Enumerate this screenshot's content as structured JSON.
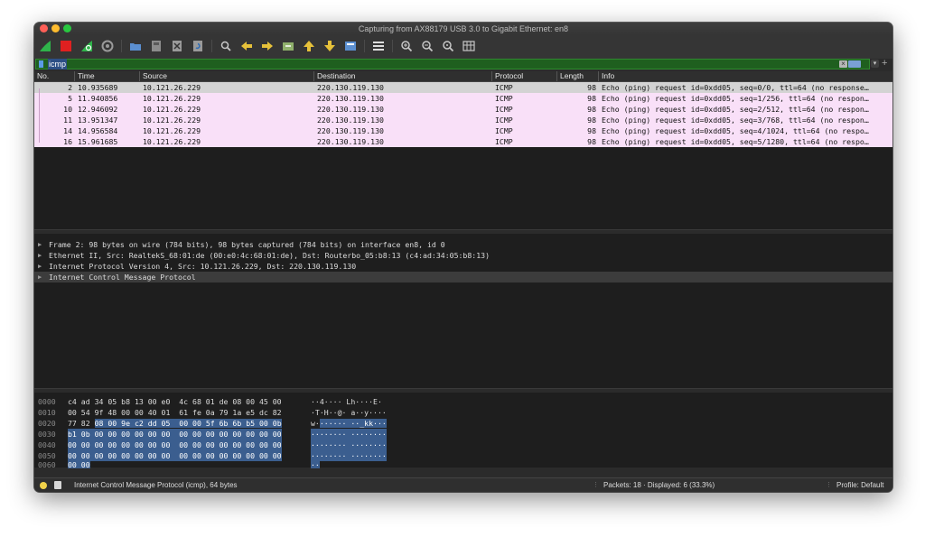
{
  "window": {
    "title": "Capturing from AX88179 USB 3.0 to Gigabit Ethernet: en8"
  },
  "toolbar": {
    "icons": [
      "shark-fin-start-icon",
      "stop-icon",
      "shark-fin-restart-icon",
      "gear-options-icon",
      "folder-open-icon",
      "file-save-icon",
      "file-close-icon",
      "reload-icon",
      "search-icon",
      "back-arrow-icon",
      "forward-arrow-icon",
      "go-to-packet-icon",
      "first-packet-icon",
      "last-packet-icon",
      "autoscroll-icon",
      "colorize-icon",
      "zoom-in-icon",
      "zoom-out-icon",
      "zoom-normal-icon",
      "resize-columns-icon"
    ]
  },
  "filter": {
    "value": "icmp"
  },
  "columns": [
    "No.",
    "Time",
    "Source",
    "Destination",
    "Protocol",
    "Length",
    "Info"
  ],
  "packets": [
    {
      "no": "2",
      "time": "10.935689",
      "src": "10.121.26.229",
      "dst": "220.130.119.130",
      "proto": "ICMP",
      "len": "98",
      "info": "Echo (ping) request  id=0xdd05, seq=0/0, ttl=64 (no response…"
    },
    {
      "no": "5",
      "time": "11.940856",
      "src": "10.121.26.229",
      "dst": "220.130.119.130",
      "proto": "ICMP",
      "len": "98",
      "info": "Echo (ping) request  id=0xdd05, seq=1/256, ttl=64 (no respon…"
    },
    {
      "no": "10",
      "time": "12.946092",
      "src": "10.121.26.229",
      "dst": "220.130.119.130",
      "proto": "ICMP",
      "len": "98",
      "info": "Echo (ping) request  id=0xdd05, seq=2/512, ttl=64 (no respon…"
    },
    {
      "no": "11",
      "time": "13.951347",
      "src": "10.121.26.229",
      "dst": "220.130.119.130",
      "proto": "ICMP",
      "len": "98",
      "info": "Echo (ping) request  id=0xdd05, seq=3/768, ttl=64 (no respon…"
    },
    {
      "no": "14",
      "time": "14.956584",
      "src": "10.121.26.229",
      "dst": "220.130.119.130",
      "proto": "ICMP",
      "len": "98",
      "info": "Echo (ping) request  id=0xdd05, seq=4/1024, ttl=64 (no respo…"
    },
    {
      "no": "16",
      "time": "15.961685",
      "src": "10.121.26.229",
      "dst": "220.130.119.130",
      "proto": "ICMP",
      "len": "98",
      "info": "Echo (ping) request  id=0xdd05, seq=5/1280, ttl=64 (no respo…"
    }
  ],
  "details": [
    "Frame 2: 98 bytes on wire (784 bits), 98 bytes captured (784 bits) on interface en8, id 0",
    "Ethernet II, Src: RealtekS_68:01:de (00:e0:4c:68:01:de), Dst: Routerbo_05:b8:13 (c4:ad:34:05:b8:13)",
    "Internet Protocol Version 4, Src: 10.121.26.229, Dst: 220.130.119.130",
    "Internet Control Message Protocol"
  ],
  "hex": [
    {
      "off": "0000",
      "b1": "c4 ad 34 05 b8 13 00 e0",
      "b2": "4c 68 01 de 08 00 45 00",
      "a": "··4···· Lh····E·"
    },
    {
      "off": "0010",
      "b1": "00 54 9f 48 00 00 40 01",
      "b2": "61 fe 0a 79 1a e5 dc 82",
      "a": "·T·H··@· a··y····"
    },
    {
      "off": "0020",
      "b1a": "77 82",
      "b1b": "08 00 9e c2 dd 05",
      "b2": "00 00 5f 6b 6b b5 00 0b",
      "aa": "w·",
      "ab": "······ ··_kk···"
    },
    {
      "off": "0030",
      "b1": "b1 0b 00 00 00 00 00 00",
      "b2": "00 00 00 00 00 00 00 00",
      "a": "········ ········"
    },
    {
      "off": "0040",
      "b1": "00 00 00 00 00 00 00 00",
      "b2": "00 00 00 00 00 00 00 00",
      "a": "········ ········"
    },
    {
      "off": "0050",
      "b1": "00 00 00 00 00 00 00 00",
      "b2": "00 00 00 00 00 00 00 00",
      "a": "········ ········"
    },
    {
      "off": "0060",
      "b1": "00 00",
      "b2": "",
      "a": "··"
    }
  ],
  "status": {
    "field": "Internet Control Message Protocol (icmp), 64 bytes",
    "packets": "Packets: 18 · Displayed: 6 (33.3%)",
    "profile": "Profile: Default"
  },
  "colors": {
    "row_bg": "#f9e0f8",
    "filter_ok": "#1f5f1f",
    "selection": "#3b5e8f"
  }
}
